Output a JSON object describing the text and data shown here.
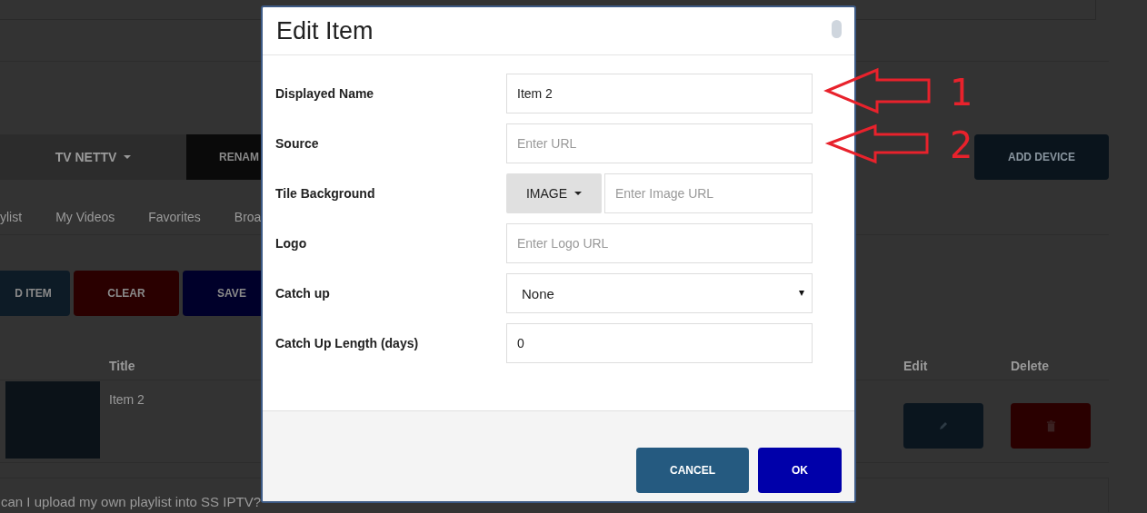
{
  "page": {
    "device_bar": {
      "device": "TV NETTV",
      "rename_button": "RENAM",
      "add_device_button": "ADD DEVICE"
    },
    "tabs": [
      {
        "label": "ylist"
      },
      {
        "label": "My Videos"
      },
      {
        "label": "Favorites"
      },
      {
        "label": "Broa"
      }
    ],
    "actions": [
      {
        "label": "D ITEM",
        "kind": "add"
      },
      {
        "label": "CLEAR",
        "kind": "clear"
      },
      {
        "label": "SAVE",
        "kind": "save"
      }
    ],
    "table": {
      "columns": [
        "Title",
        "Edit",
        "Delete"
      ],
      "rows": [
        {
          "title": "Item 2"
        }
      ]
    },
    "faq": "can I upload my own playlist into SS IPTV?"
  },
  "dialog": {
    "title": "Edit Item",
    "fields": [
      {
        "label": "Displayed Name",
        "kind": "text",
        "value": "Item 2"
      },
      {
        "label": "Source",
        "kind": "text",
        "placeholder": "Enter URL"
      },
      {
        "label": "Tile Background",
        "kind": "image",
        "button": "IMAGE",
        "placeholder": "Enter Image URL"
      },
      {
        "label": "Logo",
        "kind": "text",
        "placeholder": "Enter Logo URL"
      },
      {
        "label": "Catch up",
        "kind": "select",
        "value": "None"
      },
      {
        "label": "Catch Up Length (days)",
        "kind": "text",
        "value": "0"
      }
    ],
    "buttons": [
      {
        "label": "CANCEL",
        "kind": "cancel"
      },
      {
        "label": "OK",
        "kind": "ok"
      }
    ]
  },
  "annotations": [
    {
      "label": "1"
    },
    {
      "label": "2"
    }
  ]
}
